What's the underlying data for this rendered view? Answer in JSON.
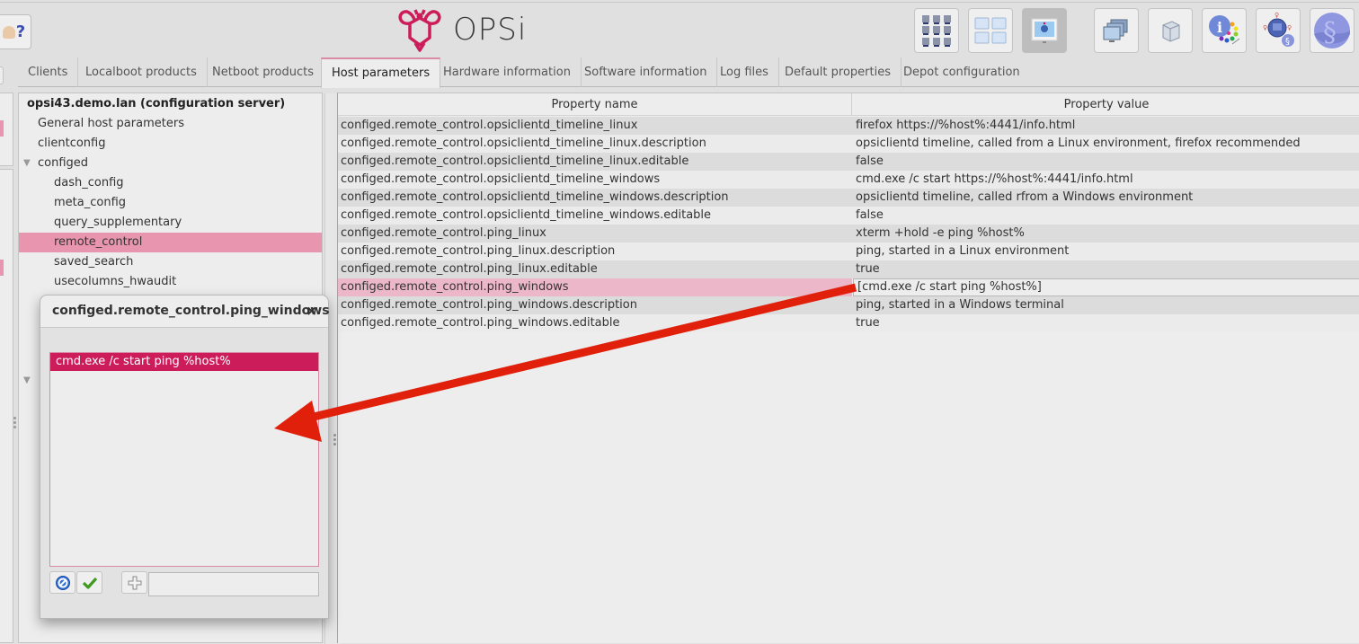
{
  "app": {
    "logo_text": "OPSi",
    "brand_color": "#cc1d5a",
    "selection_color": "#e895b0"
  },
  "toolbar": {
    "help_button": {
      "icon": "help-people-icon",
      "glyph": "?"
    },
    "buttons": [
      {
        "name": "clients-view-button",
        "icon": "clients-grid-icon",
        "active": false
      },
      {
        "name": "depots-view-button",
        "icon": "depot-folders-icon",
        "active": false
      },
      {
        "name": "server-config-button",
        "icon": "server-configuration-icon",
        "active": true
      },
      {
        "name": "client-selection-button",
        "icon": "monitors-stack-icon",
        "active": false
      },
      {
        "name": "product-packages-button",
        "icon": "package-box-icon",
        "active": false
      },
      {
        "name": "info-colors-button",
        "icon": "info-color-wheel-icon",
        "active": false
      },
      {
        "name": "license-network-button",
        "icon": "network-license-icon",
        "active": false
      },
      {
        "name": "licenses-button",
        "icon": "paragraph-license-icon",
        "active": false
      }
    ]
  },
  "tabs": [
    {
      "label": "Clients",
      "active": false
    },
    {
      "label": "Localboot products",
      "active": false
    },
    {
      "label": "Netboot products",
      "active": false
    },
    {
      "label": "Host parameters",
      "active": true
    },
    {
      "label": "Hardware information",
      "active": false
    },
    {
      "label": "Software information",
      "active": false
    },
    {
      "label": "Log files",
      "active": false
    },
    {
      "label": "Default properties",
      "active": false
    },
    {
      "label": "Depot configuration",
      "active": false
    }
  ],
  "tree": {
    "root": "opsi43.demo.lan (configuration server)",
    "items": [
      {
        "label": "General host parameters",
        "level": 1
      },
      {
        "label": "clientconfig",
        "level": 1
      },
      {
        "label": "configed",
        "level": 1,
        "expanded": true
      },
      {
        "label": "dash_config",
        "level": 2
      },
      {
        "label": "meta_config",
        "level": 2
      },
      {
        "label": "query_supplementary",
        "level": 2
      },
      {
        "label": "remote_control",
        "level": 2,
        "selected": true
      },
      {
        "label": "saved_search",
        "level": 2
      },
      {
        "label": "usecolumns_hwaudit",
        "level": 2
      }
    ]
  },
  "table": {
    "columns": [
      "Property name",
      "Property value"
    ],
    "rows": [
      {
        "name": "configed.remote_control.opsiclientd_timeline_linux",
        "value": "firefox https://%host%:4441/info.html"
      },
      {
        "name": "configed.remote_control.opsiclientd_timeline_linux.description",
        "value": "opsiclientd  timeline, called from a Linux environment, firefox recommended"
      },
      {
        "name": "configed.remote_control.opsiclientd_timeline_linux.editable",
        "value": "false"
      },
      {
        "name": "configed.remote_control.opsiclientd_timeline_windows",
        "value": "cmd.exe /c start https://%host%:4441/info.html"
      },
      {
        "name": "configed.remote_control.opsiclientd_timeline_windows.description",
        "value": "opsiclientd  timeline, called rfrom a Windows environment"
      },
      {
        "name": "configed.remote_control.opsiclientd_timeline_windows.editable",
        "value": "false"
      },
      {
        "name": "configed.remote_control.ping_linux",
        "value": "xterm +hold -e ping %host%"
      },
      {
        "name": "configed.remote_control.ping_linux.description",
        "value": "ping, started in a Linux environment"
      },
      {
        "name": "configed.remote_control.ping_linux.editable",
        "value": "true"
      },
      {
        "name": "configed.remote_control.ping_windows",
        "value": "[cmd.exe /c start ping %host%]",
        "selected": true
      },
      {
        "name": "configed.remote_control.ping_windows.description",
        "value": "ping, started in a Windows terminal"
      },
      {
        "name": "configed.remote_control.ping_windows.editable",
        "value": "true"
      }
    ]
  },
  "dialog": {
    "title": "configed.remote_control.ping_windows",
    "close_glyph": "×",
    "list_items": [
      "cmd.exe /c start ping %host%"
    ],
    "new_value_input": {
      "value": "",
      "placeholder": ""
    },
    "buttons": {
      "cancel": "cancel-icon",
      "ok": "checkmark-icon",
      "add": "plus-icon"
    }
  },
  "annotation": {
    "type": "arrow",
    "color": "#e0200a",
    "from": "selected-table-row",
    "to": "dialog-list"
  }
}
